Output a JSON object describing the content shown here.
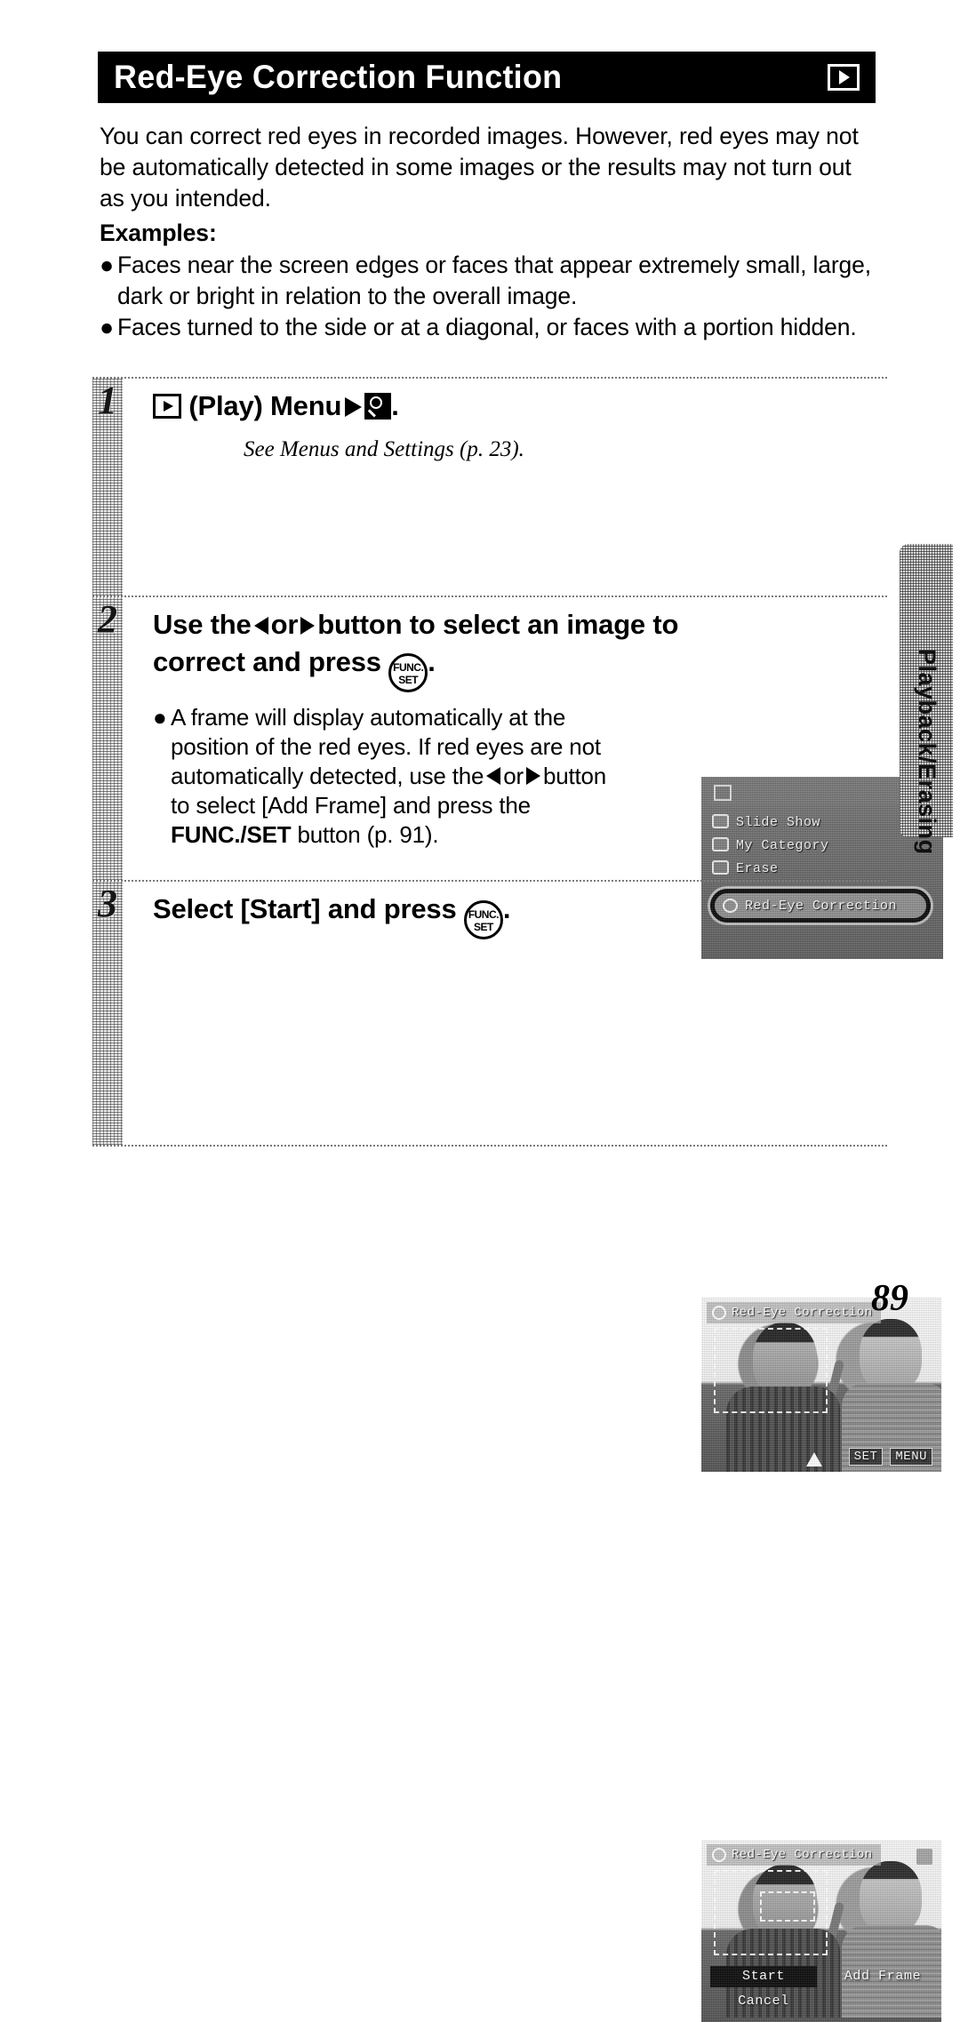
{
  "page": {
    "title": "Red-Eye Correction Function",
    "title_icon": "play-mode-icon",
    "number": "89",
    "side_tab_label": "Playback/Erasing"
  },
  "intro": {
    "paragraph": "You can correct red eyes in recorded images. However, red eyes may not be automatically detected in some images or the results may not turn out as you intended.",
    "examples_label": "Examples:",
    "bullet_marker": "●",
    "bullets": [
      "Faces near the screen edges or faces that appear extremely small, large, dark or bright in relation to the overall image.",
      "Faces turned to the side or at a diagonal, or faces with a portion hidden."
    ]
  },
  "steps": [
    {
      "number": "1",
      "head_prefix": "",
      "head_label": "(Play) Menu",
      "head_suffix": ".",
      "icons": [
        "play-icon",
        "arrow-right-icon",
        "red-eye-correction-icon"
      ],
      "note": "See Menus and Settings (p. 23)."
    },
    {
      "number": "2",
      "head_part1": "Use the",
      "head_part2": "or",
      "head_part3": "button to select an image to",
      "head_part4": "correct and press",
      "head_suffix": ".",
      "body": {
        "line1": "A frame will display automatically at",
        "line2": "the position of the red eyes.",
        "line3": "If red eyes are not automatically",
        "line4_a": "detected, use the",
        "line4_b": "or",
        "line4_c": "button to",
        "line5": "select [Add Frame] and press the",
        "line6_bold": "FUNC./SET",
        "line6_rest": "button (p. 91)."
      }
    },
    {
      "number": "3",
      "head_part1": "Select [Start] and press",
      "head_suffix": "."
    }
  ],
  "buttons": {
    "func_set_line1": "FUNC.",
    "func_set_line2": "SET"
  },
  "lcd_menu": {
    "items": [
      {
        "label": "Slide Show",
        "icon": "slideshow-icon"
      },
      {
        "label": "My Category",
        "icon": "category-icon"
      },
      {
        "label": "Erase",
        "icon": "erase-icon"
      }
    ],
    "selected_item": {
      "label": "Red-Eye Correction",
      "icon": "red-eye-correction-icon"
    }
  },
  "lcd_photo_step2": {
    "title": "Red-Eye Correction",
    "bottom_hints": [
      "SET",
      "MENU"
    ]
  },
  "lcd_photo_step3": {
    "title": "Red-Eye Correction",
    "options": [
      {
        "label": "Start",
        "selected": true
      },
      {
        "label": "Add Frame",
        "selected": false
      },
      {
        "label": "Cancel",
        "selected": false
      }
    ]
  }
}
